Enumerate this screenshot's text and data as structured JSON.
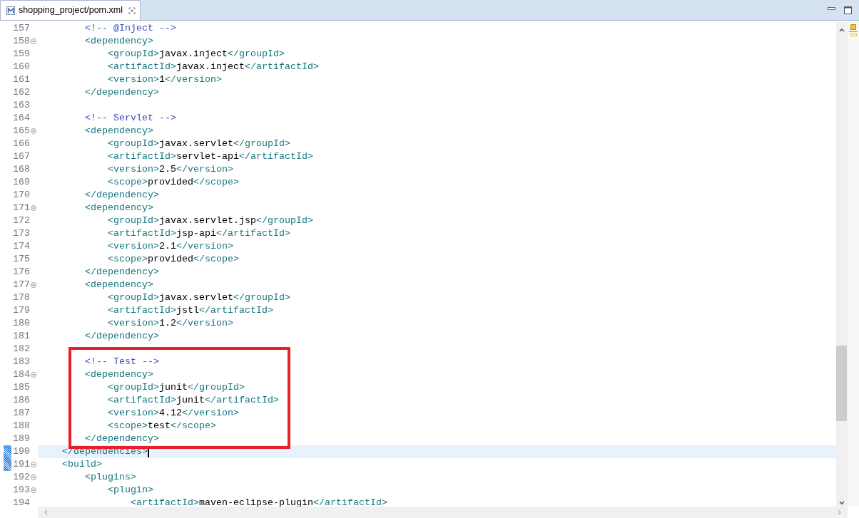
{
  "tab": {
    "title": "shopping_project/pom.xml",
    "selected": true
  },
  "lines": [
    {
      "number": "157",
      "fold": false,
      "current": false,
      "marked": false,
      "code": [
        {
          "kind": "comment",
          "text": "        <!-- @Inject -->"
        }
      ]
    },
    {
      "number": "158",
      "fold": true,
      "current": false,
      "marked": false,
      "code": [
        {
          "kind": "tag",
          "text": "        <dependency>"
        }
      ]
    },
    {
      "number": "159",
      "fold": false,
      "current": false,
      "marked": false,
      "code": [
        {
          "kind": "tag",
          "text": "            <groupId>"
        },
        {
          "kind": "text",
          "text": "javax.inject"
        },
        {
          "kind": "tag",
          "text": "</groupId>"
        }
      ]
    },
    {
      "number": "160",
      "fold": false,
      "current": false,
      "marked": false,
      "code": [
        {
          "kind": "tag",
          "text": "            <artifactId>"
        },
        {
          "kind": "text",
          "text": "javax.inject"
        },
        {
          "kind": "tag",
          "text": "</artifactId>"
        }
      ]
    },
    {
      "number": "161",
      "fold": false,
      "current": false,
      "marked": false,
      "code": [
        {
          "kind": "tag",
          "text": "            <version>"
        },
        {
          "kind": "text",
          "text": "1"
        },
        {
          "kind": "tag",
          "text": "</version>"
        }
      ]
    },
    {
      "number": "162",
      "fold": false,
      "current": false,
      "marked": false,
      "code": [
        {
          "kind": "tag",
          "text": "        </dependency>"
        }
      ]
    },
    {
      "number": "163",
      "fold": false,
      "current": false,
      "marked": false
    },
    {
      "number": "164",
      "fold": false,
      "current": false,
      "marked": false,
      "code": [
        {
          "kind": "comment",
          "text": "        <!-- Servlet -->"
        }
      ]
    },
    {
      "number": "165",
      "fold": true,
      "current": false,
      "marked": false,
      "code": [
        {
          "kind": "tag",
          "text": "        <dependency>"
        }
      ]
    },
    {
      "number": "166",
      "fold": false,
      "current": false,
      "marked": false,
      "code": [
        {
          "kind": "tag",
          "text": "            <groupId>"
        },
        {
          "kind": "text",
          "text": "javax.servlet"
        },
        {
          "kind": "tag",
          "text": "</groupId>"
        }
      ]
    },
    {
      "number": "167",
      "fold": false,
      "current": false,
      "marked": false,
      "code": [
        {
          "kind": "tag",
          "text": "            <artifactId>"
        },
        {
          "kind": "text",
          "text": "servlet-api"
        },
        {
          "kind": "tag",
          "text": "</artifactId>"
        }
      ]
    },
    {
      "number": "168",
      "fold": false,
      "current": false,
      "marked": false,
      "code": [
        {
          "kind": "tag",
          "text": "            <version>"
        },
        {
          "kind": "text",
          "text": "2.5"
        },
        {
          "kind": "tag",
          "text": "</version>"
        }
      ]
    },
    {
      "number": "169",
      "fold": false,
      "current": false,
      "marked": false,
      "code": [
        {
          "kind": "tag",
          "text": "            <scope>"
        },
        {
          "kind": "text",
          "text": "provided"
        },
        {
          "kind": "tag",
          "text": "</scope>"
        }
      ]
    },
    {
      "number": "170",
      "fold": false,
      "current": false,
      "marked": false,
      "code": [
        {
          "kind": "tag",
          "text": "        </dependency>"
        }
      ]
    },
    {
      "number": "171",
      "fold": true,
      "current": false,
      "marked": false,
      "code": [
        {
          "kind": "tag",
          "text": "        <dependency>"
        }
      ]
    },
    {
      "number": "172",
      "fold": false,
      "current": false,
      "marked": false,
      "code": [
        {
          "kind": "tag",
          "text": "            <groupId>"
        },
        {
          "kind": "text",
          "text": "javax.servlet.jsp"
        },
        {
          "kind": "tag",
          "text": "</groupId>"
        }
      ]
    },
    {
      "number": "173",
      "fold": false,
      "current": false,
      "marked": false,
      "code": [
        {
          "kind": "tag",
          "text": "            <artifactId>"
        },
        {
          "kind": "text",
          "text": "jsp-api"
        },
        {
          "kind": "tag",
          "text": "</artifactId>"
        }
      ]
    },
    {
      "number": "174",
      "fold": false,
      "current": false,
      "marked": false,
      "code": [
        {
          "kind": "tag",
          "text": "            <version>"
        },
        {
          "kind": "text",
          "text": "2.1"
        },
        {
          "kind": "tag",
          "text": "</version>"
        }
      ]
    },
    {
      "number": "175",
      "fold": false,
      "current": false,
      "marked": false,
      "code": [
        {
          "kind": "tag",
          "text": "            <scope>"
        },
        {
          "kind": "text",
          "text": "provided"
        },
        {
          "kind": "tag",
          "text": "</scope>"
        }
      ]
    },
    {
      "number": "176",
      "fold": false,
      "current": false,
      "marked": false,
      "code": [
        {
          "kind": "tag",
          "text": "        </dependency>"
        }
      ]
    },
    {
      "number": "177",
      "fold": true,
      "current": false,
      "marked": false,
      "code": [
        {
          "kind": "tag",
          "text": "        <dependency>"
        }
      ]
    },
    {
      "number": "178",
      "fold": false,
      "current": false,
      "marked": false,
      "code": [
        {
          "kind": "tag",
          "text": "            <groupId>"
        },
        {
          "kind": "text",
          "text": "javax.servlet"
        },
        {
          "kind": "tag",
          "text": "</groupId>"
        }
      ]
    },
    {
      "number": "179",
      "fold": false,
      "current": false,
      "marked": false,
      "code": [
        {
          "kind": "tag",
          "text": "            <artifactId>"
        },
        {
          "kind": "text",
          "text": "jstl"
        },
        {
          "kind": "tag",
          "text": "</artifactId>"
        }
      ]
    },
    {
      "number": "180",
      "fold": false,
      "current": false,
      "marked": false,
      "code": [
        {
          "kind": "tag",
          "text": "            <version>"
        },
        {
          "kind": "text",
          "text": "1.2"
        },
        {
          "kind": "tag",
          "text": "</version>"
        }
      ]
    },
    {
      "number": "181",
      "fold": false,
      "current": false,
      "marked": false,
      "code": [
        {
          "kind": "tag",
          "text": "        </dependency>"
        }
      ]
    },
    {
      "number": "182",
      "fold": false,
      "current": false,
      "marked": false
    },
    {
      "number": "183",
      "fold": false,
      "current": false,
      "marked": false,
      "code": [
        {
          "kind": "comment",
          "text": "        <!-- Test -->"
        }
      ]
    },
    {
      "number": "184",
      "fold": true,
      "current": false,
      "marked": false,
      "code": [
        {
          "kind": "tag",
          "text": "        <dependency>"
        }
      ]
    },
    {
      "number": "185",
      "fold": false,
      "current": false,
      "marked": false,
      "code": [
        {
          "kind": "tag",
          "text": "            <groupId>"
        },
        {
          "kind": "text",
          "text": "junit"
        },
        {
          "kind": "tag",
          "text": "</groupId>"
        }
      ]
    },
    {
      "number": "186",
      "fold": false,
      "current": false,
      "marked": false,
      "code": [
        {
          "kind": "tag",
          "text": "            <artifactId>"
        },
        {
          "kind": "text",
          "text": "junit"
        },
        {
          "kind": "tag",
          "text": "</artifactId>"
        }
      ]
    },
    {
      "number": "187",
      "fold": false,
      "current": false,
      "marked": false,
      "code": [
        {
          "kind": "tag",
          "text": "            <version>"
        },
        {
          "kind": "text",
          "text": "4.12"
        },
        {
          "kind": "tag",
          "text": "</version>"
        }
      ]
    },
    {
      "number": "188",
      "fold": false,
      "current": false,
      "marked": false,
      "code": [
        {
          "kind": "tag",
          "text": "            <scope>"
        },
        {
          "kind": "text",
          "text": "test"
        },
        {
          "kind": "tag",
          "text": "</scope>"
        }
      ]
    },
    {
      "number": "189",
      "fold": false,
      "current": false,
      "marked": false,
      "code": [
        {
          "kind": "tag",
          "text": "        </dependency>"
        }
      ]
    },
    {
      "number": "190",
      "fold": false,
      "current": true,
      "marked": true,
      "code": [
        {
          "kind": "tag",
          "text": "    </dependencies>"
        }
      ]
    },
    {
      "number": "191",
      "fold": true,
      "current": false,
      "marked": true,
      "code": [
        {
          "kind": "tag",
          "text": "    <build>"
        }
      ]
    },
    {
      "number": "192",
      "fold": true,
      "current": false,
      "marked": false,
      "code": [
        {
          "kind": "tag",
          "text": "        <plugins>"
        }
      ]
    },
    {
      "number": "193",
      "fold": true,
      "current": false,
      "marked": false,
      "code": [
        {
          "kind": "tag",
          "text": "            <plugin>"
        }
      ]
    },
    {
      "number": "194",
      "fold": false,
      "current": false,
      "marked": false,
      "code": [
        {
          "kind": "tag",
          "text": "                <artifactId>"
        },
        {
          "kind": "text",
          "text": "maven-eclipse-plugin"
        },
        {
          "kind": "tag",
          "text": "</artifactId>"
        }
      ]
    }
  ]
}
